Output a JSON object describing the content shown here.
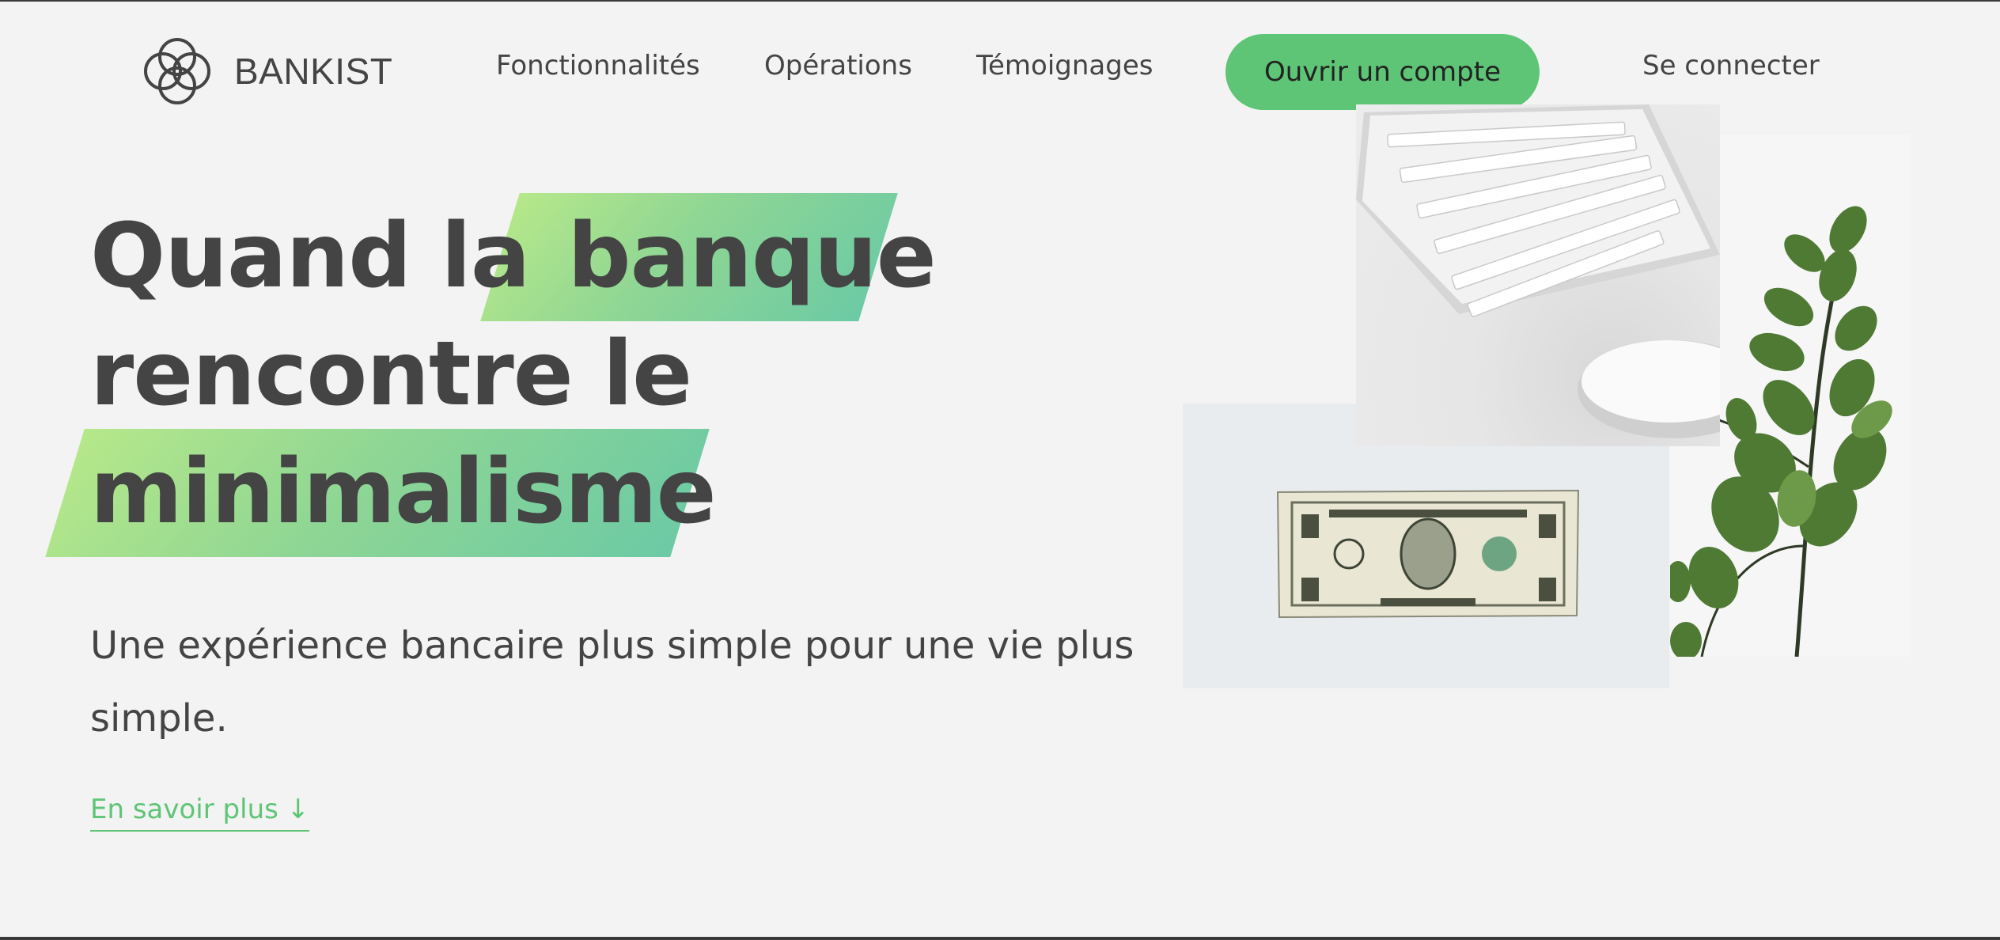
{
  "brand": {
    "name": "BANKIST",
    "accent": "#5ec576",
    "text_color": "#444444"
  },
  "nav": {
    "links": [
      "Fonctionnalités",
      "Opérations",
      "Témoignages"
    ],
    "cta_label": "Ouvrir un compte",
    "login_label": "Se connecter"
  },
  "hero": {
    "line1_prefix": "Quand la",
    "line1_highlight": "banque",
    "line2": "rencontre le",
    "line3_highlight": "minimalisme",
    "subtitle": "Une expérience bancaire plus simple pour une vie plus simple.",
    "learn_more": "En savoir plus ↓"
  },
  "images": {
    "keyboard": "keyboard-and-mouse",
    "dollar": "one-dollar-bill",
    "plant": "eucalyptus-plant"
  }
}
